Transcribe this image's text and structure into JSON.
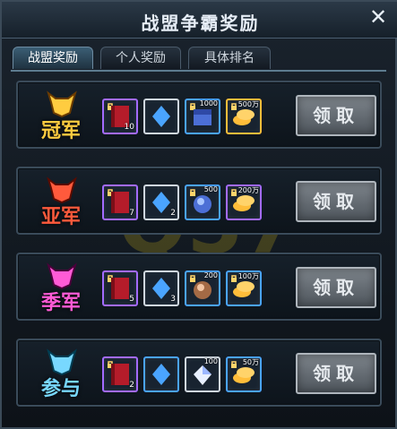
{
  "window": {
    "title": "战盟争霸奖励",
    "close_icon": "close-icon"
  },
  "tabs": [
    {
      "label": "战盟奖励",
      "active": true
    },
    {
      "label": "个人奖励",
      "active": false
    },
    {
      "label": "具体排名",
      "active": false
    }
  ],
  "rows": [
    {
      "rank_label": "冠军",
      "rank_color": "#ffcc40",
      "items": [
        {
          "icon": "red-scroll-icon",
          "border": "purple",
          "count": "10"
        },
        {
          "icon": "blue-crystal-icon",
          "border": "white",
          "count": ""
        },
        {
          "icon": "blue-chest-icon",
          "border": "blue",
          "count": "1000"
        },
        {
          "icon": "gold-coins-icon",
          "border": "gold",
          "count": "500万"
        }
      ],
      "claim_label": "领取"
    },
    {
      "rank_label": "亚军",
      "rank_color": "#ff5a3c",
      "items": [
        {
          "icon": "red-scroll-icon",
          "border": "purple",
          "count": "7"
        },
        {
          "icon": "blue-crystal-icon",
          "border": "white",
          "count": "2"
        },
        {
          "icon": "blue-orb-icon",
          "border": "blue",
          "count": "500"
        },
        {
          "icon": "gold-coins-icon",
          "border": "purple",
          "count": "200万"
        }
      ],
      "claim_label": "领取"
    },
    {
      "rank_label": "季军",
      "rank_color": "#ff5bd6",
      "items": [
        {
          "icon": "red-scroll-icon",
          "border": "purple",
          "count": "5"
        },
        {
          "icon": "blue-crystal-icon",
          "border": "white",
          "count": "3"
        },
        {
          "icon": "bronze-orb-icon",
          "border": "blue",
          "count": "200"
        },
        {
          "icon": "gold-coins-icon",
          "border": "blue",
          "count": "100万"
        }
      ],
      "claim_label": "领取"
    },
    {
      "rank_label": "参与",
      "rank_color": "#78d8ff",
      "items": [
        {
          "icon": "red-scroll-icon",
          "border": "purple",
          "count": "2"
        },
        {
          "icon": "blue-crystal-icon",
          "border": "blue",
          "count": ""
        },
        {
          "icon": "white-diamond-icon",
          "border": "white",
          "count": "100"
        },
        {
          "icon": "gold-coins-icon",
          "border": "blue",
          "count": "50万"
        }
      ],
      "claim_label": "领取"
    }
  ]
}
